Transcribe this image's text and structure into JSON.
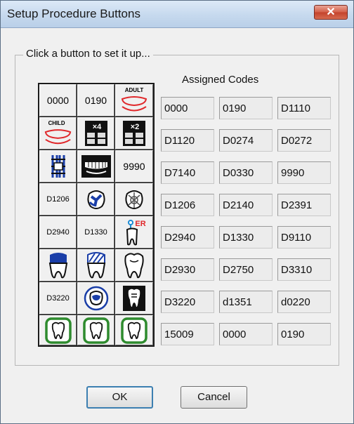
{
  "window": {
    "title": "Setup Procedure Buttons",
    "close_glyph": "✕"
  },
  "group": {
    "label": "Click a button to set it up..."
  },
  "assigned": {
    "title": "Assigned Codes"
  },
  "buttons": {
    "r0c0": "0000",
    "r0c1": "0190",
    "r0c2": "ADULT",
    "r1c0": "CHILD",
    "r1c1": "×4",
    "r1c2": "×2",
    "r2c0": "",
    "r2c1": "",
    "r2c2": "9990",
    "r3c0": "D1206",
    "r3c1": "",
    "r3c2": "",
    "r4c0": "D2940",
    "r4c1": "D1330",
    "r4c2": "ER",
    "r5c0": "",
    "r5c1": "",
    "r5c2": "",
    "r6c0": "D3220",
    "r6c1": "",
    "r6c2": "",
    "r7c0": "",
    "r7c1": "",
    "r7c2": ""
  },
  "icons": {
    "r0c2": "adult-dentures-icon",
    "r1c0": "child-dentures-icon",
    "r1c1": "xray-x4-icon",
    "r1c2": "xray-x2-icon",
    "r2c0": "ortho-appliance-icon",
    "r2c1": "dentures-dark-icon",
    "r3c1": "sealant-tooth-icon",
    "r3c2": "tooth-crack-icon",
    "r4c2": "emergency-tooth-icon",
    "r5c0": "crown-blue-icon",
    "r5c1": "crown-striped-icon",
    "r5c2": "tooth-outline-icon",
    "r6c1": "root-canal-icon",
    "r6c2": "tooth-dark-icon",
    "r7c0": "green-tooth-icon",
    "r7c1": "green-tooth-icon",
    "r7c2": "green-tooth-icon"
  },
  "codes": [
    [
      "0000",
      "0190",
      "D1110"
    ],
    [
      "D1120",
      "D0274",
      "D0272"
    ],
    [
      "D7140",
      "D0330",
      "9990"
    ],
    [
      "D1206",
      "D2140",
      "D2391"
    ],
    [
      "D2940",
      "D1330",
      "D9110"
    ],
    [
      "D2930",
      "D2750",
      "D3310"
    ],
    [
      "D3220",
      "d1351",
      "d0220"
    ],
    [
      "15009",
      "0000",
      "0190"
    ]
  ],
  "footer": {
    "ok_label": "OK",
    "cancel_label": "Cancel"
  },
  "colors": {
    "title_bar": "#c6d9ee",
    "close_button": "#c4432c",
    "dialog_bg": "#f0f0f0",
    "green_frame": "#2e8b2e",
    "denture_red": "#e0282b",
    "er_red": "#e0282b",
    "tooth_blue": "#1a3ea8"
  }
}
